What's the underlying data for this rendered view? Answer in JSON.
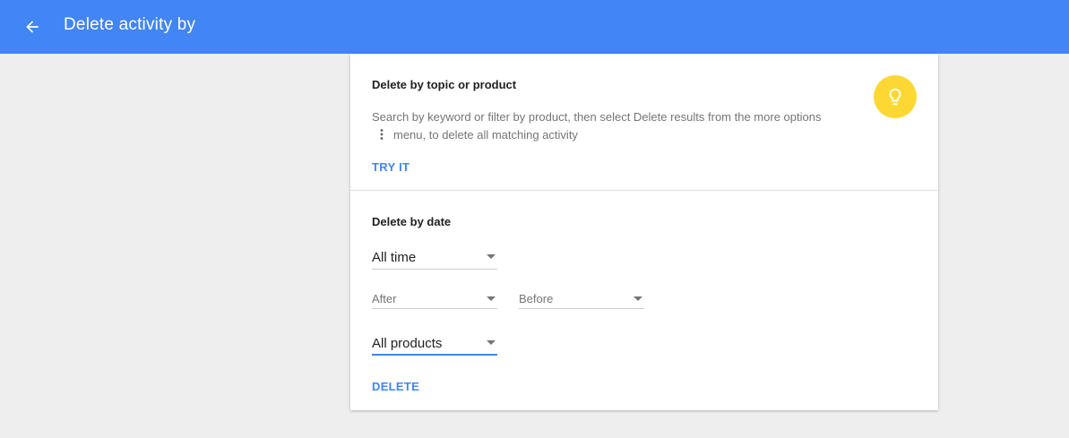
{
  "appbar": {
    "title": "Delete activity by",
    "back_icon": "arrow-back-icon",
    "color": "#4285f4"
  },
  "topic_section": {
    "title": "Delete by topic or product",
    "desc_before": "Search by keyword or filter by product, then select Delete results from the more options",
    "desc_icon": "more-vert-icon",
    "desc_after": "menu, to delete all matching activity",
    "action_label": "TRY IT",
    "tip_icon": "lightbulb-icon",
    "tip_color": "#fdd835"
  },
  "date_section": {
    "title": "Delete by date",
    "range_value": "All time",
    "after_value": "After",
    "before_value": "Before",
    "products_value": "All products",
    "delete_label": "DELETE"
  }
}
